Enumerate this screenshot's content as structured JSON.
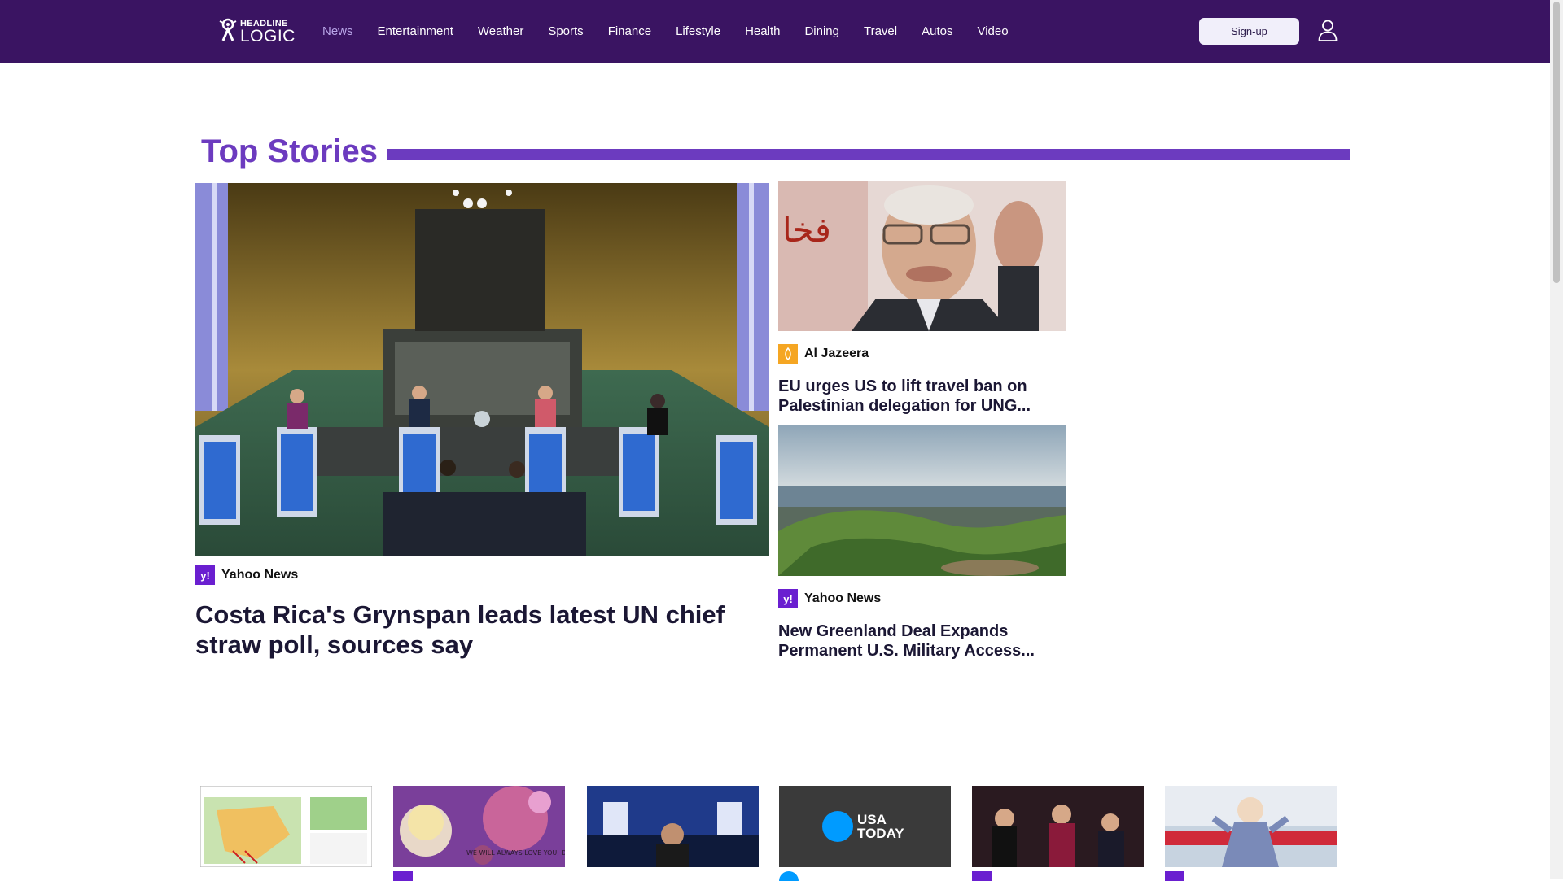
{
  "header": {
    "logo": {
      "line1": "HEADLINE",
      "line2": "LOGIC"
    },
    "nav": [
      "News",
      "Entertainment",
      "Weather",
      "Sports",
      "Finance",
      "Lifestyle",
      "Health",
      "Dining",
      "Travel",
      "Autos",
      "Video"
    ],
    "active_nav": "News",
    "signup_label": "Sign-up",
    "user_icon": "user-icon"
  },
  "colors": {
    "header_bg": "#3a1462",
    "accent": "#6c3bbf",
    "active_nav": "#b9a6e8"
  },
  "top_stories": {
    "title": "Top Stories",
    "main": {
      "source": "Yahoo News",
      "source_icon": "y!",
      "headline": "Costa Rica's Grynspan leads latest UN chief straw poll, sources say"
    },
    "side": [
      {
        "source": "Al Jazeera",
        "source_icon": "al-jazeera-icon",
        "headline": "EU urges US to lift travel ban on Palestinian delegation for UNG..."
      },
      {
        "source": "Yahoo News",
        "source_icon": "y!",
        "headline": "New Greenland Deal Expands Permanent U.S. Military Access..."
      }
    ]
  },
  "thumbnails": {
    "usa_today": {
      "line1": "USA",
      "line2": "TODAY"
    },
    "dolly_text": "WE WILL ALWAYS LOVE YOU, DOLLY"
  }
}
